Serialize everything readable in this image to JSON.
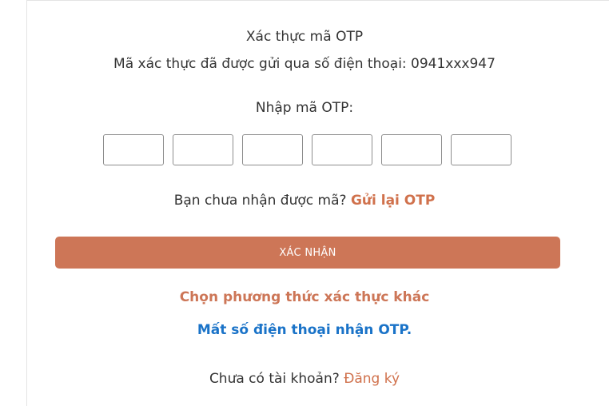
{
  "header": {
    "title": "Xác thực mã OTP",
    "subtitle": "Mã xác thực đã được gửi qua số điện thoại: 0941xxx947"
  },
  "otp": {
    "label": "Nhập mã OTP:",
    "digits": [
      "",
      "",
      "",
      "",
      "",
      ""
    ]
  },
  "resend": {
    "question": "Bạn chưa nhận được mã?",
    "link": "Gửi lại OTP"
  },
  "confirm_label": "XÁC NHẬN",
  "links": {
    "other_method": "Chọn phương thức xác thực khác",
    "lost_phone": "Mất số điện thoại nhận OTP."
  },
  "signup": {
    "question": "Chưa có tài khoản?",
    "link": "Đăng ký"
  },
  "colors": {
    "accent": "#cd7657",
    "link_blue": "#1a73c8",
    "text": "#333333"
  }
}
